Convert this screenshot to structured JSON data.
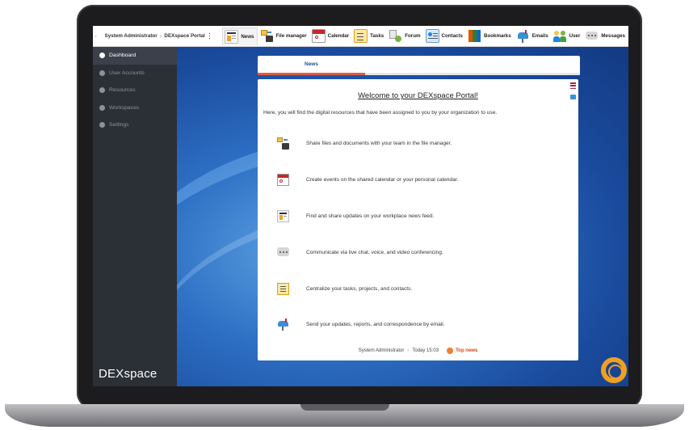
{
  "topbar": {
    "user": "System Administrator",
    "portal": "DEXspace Portal",
    "nav": [
      {
        "label": "News",
        "icon": "news-icon",
        "active": true
      },
      {
        "label": "File manager",
        "icon": "file-manager-icon"
      },
      {
        "label": "Calendar",
        "icon": "calendar-icon"
      },
      {
        "label": "Tasks",
        "icon": "tasks-icon"
      },
      {
        "label": "Forum",
        "icon": "forum-icon"
      },
      {
        "label": "Contacts",
        "icon": "contacts-icon"
      },
      {
        "label": "Bookmarks",
        "icon": "bookmarks-icon"
      },
      {
        "label": "Emails",
        "icon": "emails-icon"
      },
      {
        "label": "User",
        "icon": "user-icon"
      },
      {
        "label": "Messages",
        "icon": "messages-icon"
      }
    ]
  },
  "sidebar": {
    "items": [
      {
        "label": "Dashboard",
        "icon": "info-icon",
        "active": true
      },
      {
        "label": "User Accounts",
        "icon": "users-icon"
      },
      {
        "label": "Resources",
        "icon": "resources-icon"
      },
      {
        "label": "Workspaces",
        "icon": "workspaces-icon"
      },
      {
        "label": "Settings",
        "icon": "settings-icon"
      }
    ],
    "brand": "DEXspace"
  },
  "tabs": {
    "news": "News"
  },
  "card": {
    "title": "Welcome to your DEXspace Portal!",
    "intro": "Here, you will find the digital resources that have been assigned to you by your organization to use.",
    "features": [
      {
        "icon": "file-manager-icon",
        "text": "Share files and documents with your team in the file manager."
      },
      {
        "icon": "calendar-icon",
        "text": "Create events on the shared calendar or your personal calendar."
      },
      {
        "icon": "news-icon",
        "text": "Find and share updates on your workplace news feed."
      },
      {
        "icon": "chat-icon",
        "text": "Communicate via live chat, voice, and video conferencing."
      },
      {
        "icon": "tasks-icon",
        "text": "Centralize your tasks, projects, and contacts."
      },
      {
        "icon": "mailbox-icon",
        "text": "Send your updates, reports, and correspondence by email."
      }
    ],
    "footer": {
      "author": "System Administrator",
      "time": "Today 15:03",
      "tag": "Top news"
    }
  },
  "colors": {
    "accent": "#1a4f9e",
    "tab_underline": "#e05c45",
    "sidebar": "#2b2f36",
    "help": "#f0a020"
  }
}
